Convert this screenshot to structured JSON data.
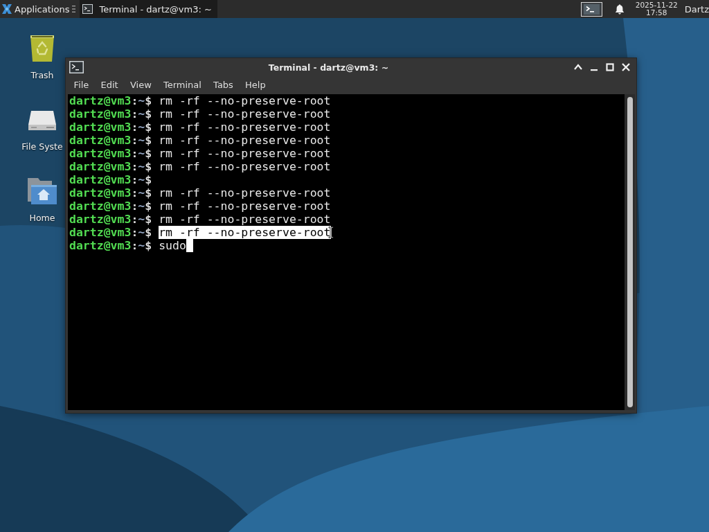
{
  "top_panel": {
    "applications_menu": {
      "label": "Applications"
    },
    "tasks": [
      {
        "label": "Terminal - dartz@vm3: ~",
        "selected": true
      }
    ],
    "clock": {
      "date": "2025-11-22",
      "time": "17:58"
    },
    "user_name": "Dartz"
  },
  "desktop_icons": [
    {
      "kind": "trash",
      "label": "Trash"
    },
    {
      "kind": "drive",
      "label": "File Syste"
    },
    {
      "kind": "home",
      "label": "Home"
    }
  ],
  "terminal_window": {
    "title": "Terminal - dartz@vm3: ~",
    "menu": [
      "File",
      "Edit",
      "View",
      "Terminal",
      "Tabs",
      "Help"
    ],
    "lines": [
      {
        "user_host": "dartz@vm3",
        "separator": ":",
        "path": "~",
        "symbol": "$",
        "command": "rm -rf --no-preserve-root",
        "selected": false,
        "cursor": false
      },
      {
        "user_host": "dartz@vm3",
        "separator": ":",
        "path": "~",
        "symbol": "$",
        "command": "rm -rf --no-preserve-root",
        "selected": false,
        "cursor": false
      },
      {
        "user_host": "dartz@vm3",
        "separator": ":",
        "path": "~",
        "symbol": "$",
        "command": "rm -rf --no-preserve-root",
        "selected": false,
        "cursor": false
      },
      {
        "user_host": "dartz@vm3",
        "separator": ":",
        "path": "~",
        "symbol": "$",
        "command": "rm -rf --no-preserve-root",
        "selected": false,
        "cursor": false
      },
      {
        "user_host": "dartz@vm3",
        "separator": ":",
        "path": "~",
        "symbol": "$",
        "command": "rm -rf --no-preserve-root",
        "selected": false,
        "cursor": false
      },
      {
        "user_host": "dartz@vm3",
        "separator": ":",
        "path": "~",
        "symbol": "$",
        "command": "rm -rf --no-preserve-root",
        "selected": false,
        "cursor": false
      },
      {
        "user_host": "dartz@vm3",
        "separator": ":",
        "path": "~",
        "symbol": "$",
        "selected": false,
        "cursor": false
      },
      {
        "user_host": "dartz@vm3",
        "separator": ":",
        "path": "~",
        "symbol": "$",
        "command": "rm -rf --no-preserve-root",
        "selected": false,
        "cursor": false
      },
      {
        "user_host": "dartz@vm3",
        "separator": ":",
        "path": "~",
        "symbol": "$",
        "command": "rm -rf --no-preserve-root",
        "selected": false,
        "cursor": false
      },
      {
        "user_host": "dartz@vm3",
        "separator": ":",
        "path": "~",
        "symbol": "$",
        "command": "rm -rf --no-preserve-root",
        "selected": false,
        "cursor": false
      },
      {
        "user_host": "dartz@vm3",
        "separator": ":",
        "path": "~",
        "symbol": "$",
        "command": "rm -rf --no-preserve-root",
        "selected": true,
        "cursor": false
      },
      {
        "user_host": "dartz@vm3",
        "separator": ":",
        "path": "~",
        "symbol": "$",
        "command": "sudo",
        "selected": false,
        "cursor": true
      }
    ]
  }
}
